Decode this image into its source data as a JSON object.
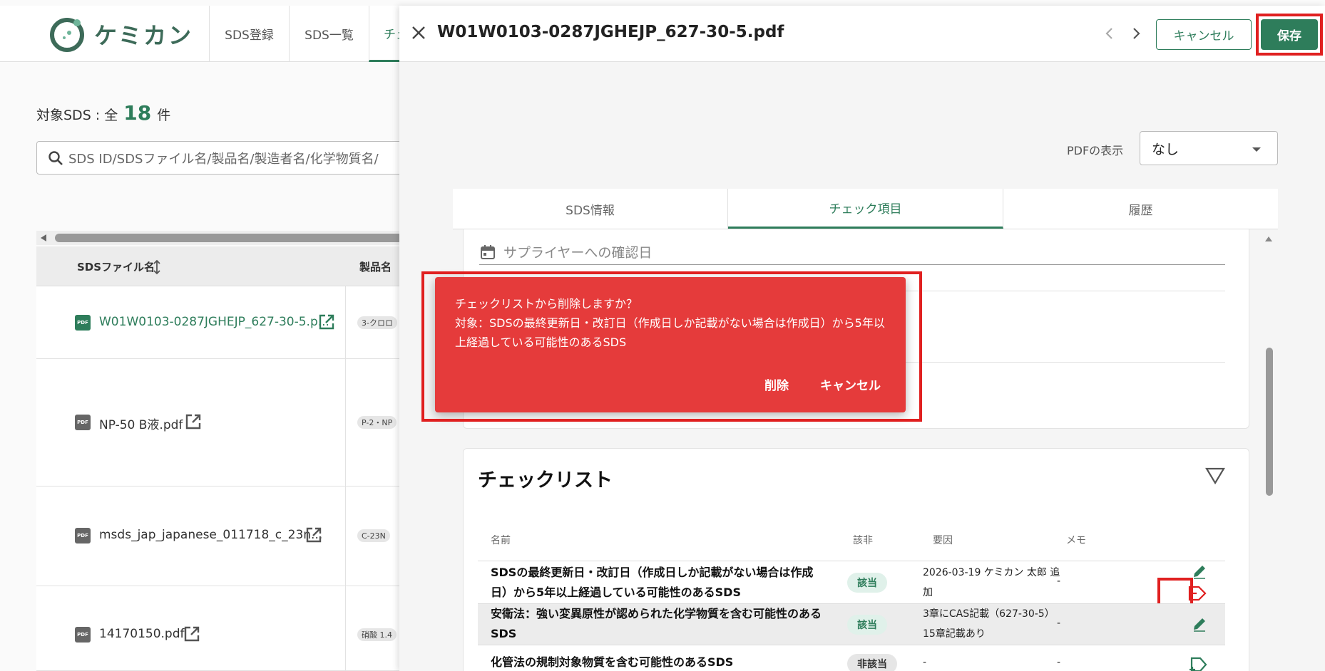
{
  "app": {
    "logo_text": "ケミカン",
    "nav_tabs": [
      "SDS登録",
      "SDS一覧",
      "チェ"
    ]
  },
  "list": {
    "count_prefix": "対象SDS : 全",
    "count_value": "18",
    "count_suffix": "件",
    "search_placeholder": "SDS ID/SDSファイル名/製品名/製造者名/化学物質名/",
    "columns": [
      "SDSファイル名",
      "製品名"
    ],
    "rows": [
      {
        "file": "W01W0103-0287JGHEJP_627-30-5.p...",
        "product": "3-クロロ"
      },
      {
        "file": "NP-50 B液.pdf",
        "product": "P-2・NP"
      },
      {
        "file": "msds_jap_japanese_011718_c_23n...",
        "product": "C-23N"
      },
      {
        "file": "14170150.pdf",
        "product": "硝酸 1.4"
      }
    ],
    "pdf_badge": "PDF"
  },
  "drawer": {
    "title": "W01W0103-0287JGHEJP_627-30-5.pdf",
    "cancel_label": "キャンセル",
    "save_label": "保存",
    "pdf_view_label": "PDFの表示",
    "pdf_view_value": "なし",
    "tabs": [
      "SDS情報",
      "チェック項目",
      "履歴"
    ],
    "date_placeholder": "サプライヤーへの確認日"
  },
  "checklist": {
    "title": "チェックリスト",
    "headers": [
      "名前",
      "該非",
      "要因",
      "メモ"
    ],
    "rows": [
      {
        "name": "SDSの最終更新日・改訂日（作成日しか記載がない場合は作成日）から5年以上経過している可能性のあるSDS",
        "status": "該当",
        "reason": "2026-03-19 ケミカン 太郎 追加",
        "memo": "-"
      },
      {
        "name": "安衛法：強い変異原性が認められた化学物質を含む可能性のあるSDS",
        "status": "該当",
        "reason": "3章にCAS記載（627-30-5）15章記載あり",
        "memo": "-"
      },
      {
        "name": "化管法の規制対象物質を含む可能性のあるSDS",
        "status": "非該当",
        "reason": "-",
        "memo": "-"
      }
    ]
  },
  "dialog": {
    "message": "チェックリストから削除しますか？\n対象：SDSの最終更新日・改訂日（作成日しか記載がない場合は作成日）から5年以上経過している可能性のあるSDS",
    "delete_label": "削除",
    "cancel_label": "キャンセル"
  },
  "colors": {
    "accent": "#2e7d5b",
    "dialog_bg": "#e53b3b",
    "highlight": "#e02020"
  }
}
